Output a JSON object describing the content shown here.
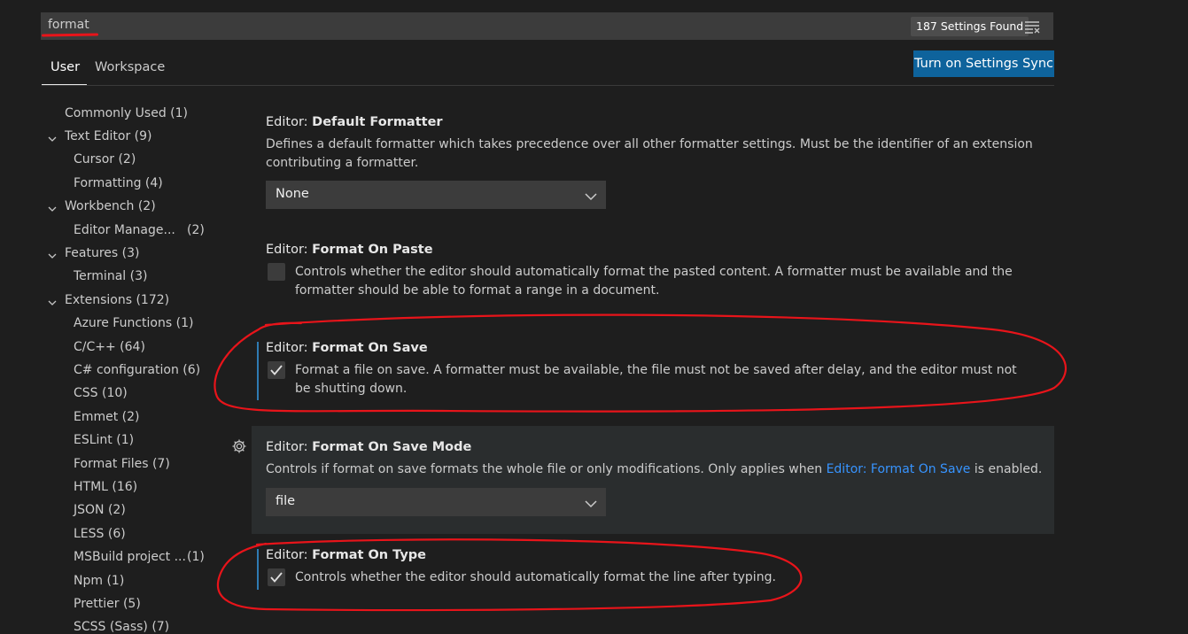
{
  "search": {
    "value": "format",
    "count_label": "187 Settings Found"
  },
  "tabs": [
    {
      "label": "User"
    },
    {
      "label": "Workspace"
    }
  ],
  "sync_button_label": "Turn on Settings Sync",
  "toc": {
    "items": [
      {
        "label": "Commonly Used (1)"
      },
      {
        "label": "Text Editor (9)",
        "expanded": true
      },
      {
        "label": "Cursor (2)"
      },
      {
        "label": "Formatting (4)"
      },
      {
        "label": "Workbench (2)",
        "expanded": true
      },
      {
        "label": "Editor Manage...",
        "count": "(2)"
      },
      {
        "label": "Features (3)",
        "expanded": true
      },
      {
        "label": "Terminal (3)"
      },
      {
        "label": "Extensions (172)",
        "expanded": true
      },
      {
        "label": "Azure Functions (1)"
      },
      {
        "label": "C/C++ (64)"
      },
      {
        "label": "C# configuration (6)"
      },
      {
        "label": "CSS (10)"
      },
      {
        "label": "Emmet (2)"
      },
      {
        "label": "ESLint (1)"
      },
      {
        "label": "Format Files (7)"
      },
      {
        "label": "HTML (16)"
      },
      {
        "label": "JSON (2)"
      },
      {
        "label": "LESS (6)"
      },
      {
        "label": "MSBuild project ...",
        "count": "(1)"
      },
      {
        "label": "Npm (1)"
      },
      {
        "label": "Prettier (5)"
      },
      {
        "label": "SCSS (Sass) (7)"
      }
    ]
  },
  "settings": {
    "default_formatter": {
      "category": "Editor: ",
      "name": "Default Formatter",
      "description": "Defines a default formatter which takes precedence over all other formatter settings. Must be the identifier of an extension contributing a formatter.",
      "value": "None"
    },
    "format_on_paste": {
      "category": "Editor: ",
      "name": "Format On Paste",
      "description": "Controls whether the editor should automatically format the pasted content. A formatter must be available and the formatter should be able to format a range in a document.",
      "checked": false
    },
    "format_on_save": {
      "category": "Editor: ",
      "name": "Format On Save",
      "description": "Format a file on save. A formatter must be available, the file must not be saved after delay, and the editor must not be shutting down.",
      "checked": true
    },
    "format_on_save_mode": {
      "category": "Editor: ",
      "name": "Format On Save Mode",
      "description_before": "Controls if format on save formats the whole file or only modifications. Only applies when ",
      "description_link": "Editor: Format On Save",
      "description_after": " is enabled.",
      "value": "file"
    },
    "format_on_type": {
      "category": "Editor: ",
      "name": "Format On Type",
      "description": "Controls whether the editor should automatically format the line after typing.",
      "checked": true
    }
  },
  "colors": {
    "background": "#1e1e1e",
    "accent_button": "#0e639c",
    "annotation": "#e8141a",
    "link": "#3794ff"
  }
}
